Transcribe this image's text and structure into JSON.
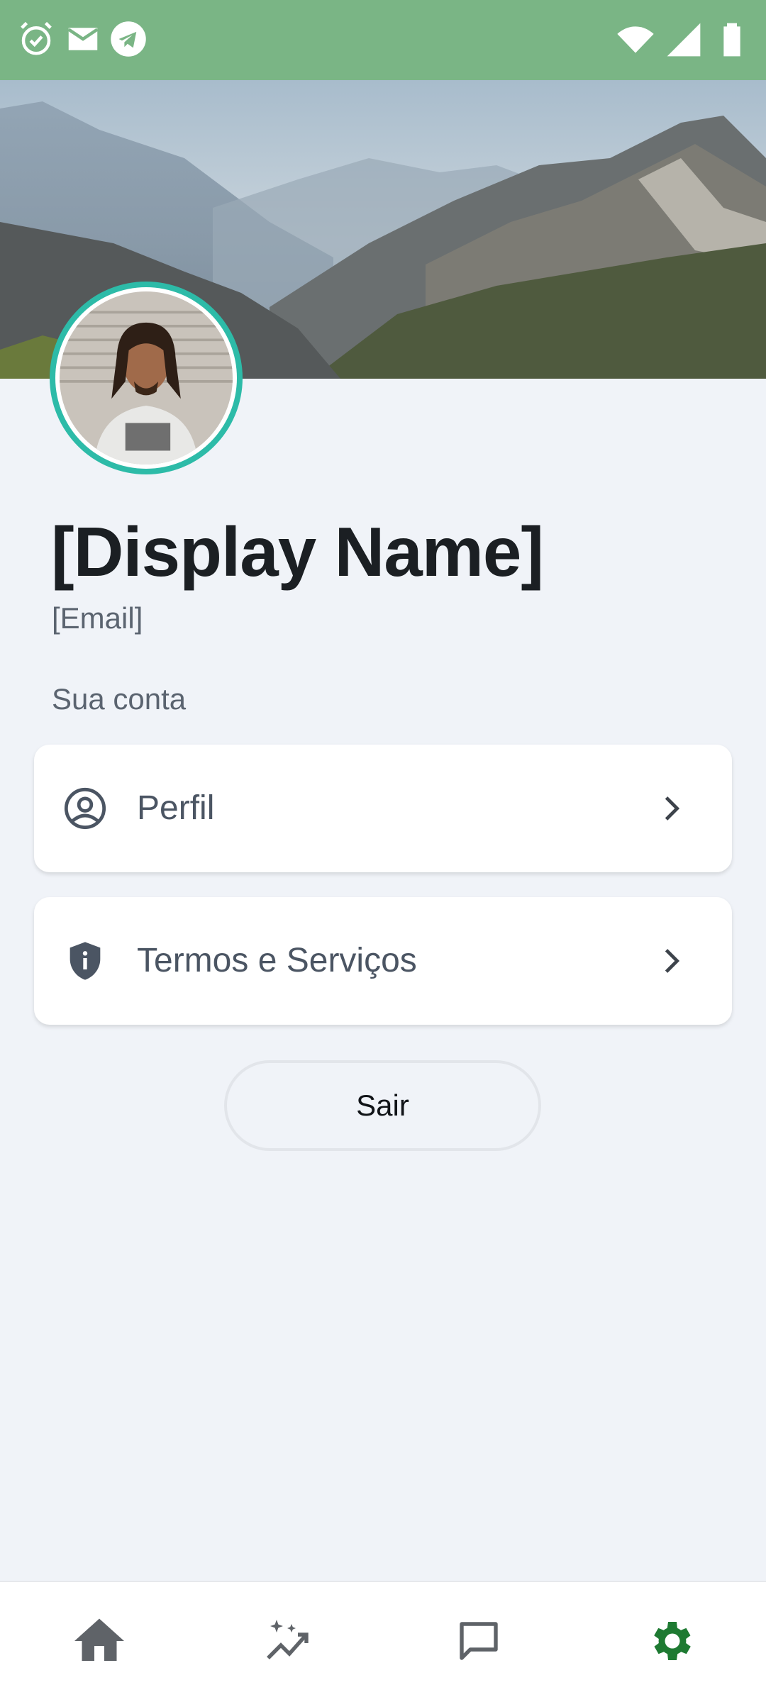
{
  "status_bar": {
    "left_icons": [
      "alarm-icon",
      "mail-icon",
      "telegram-icon"
    ],
    "right_icons": [
      "wifi-icon",
      "signal-icon",
      "battery-icon"
    ],
    "background_color": "#7ab585"
  },
  "header": {
    "banner": "mountain-landscape-image",
    "avatar": "user-photo"
  },
  "profile": {
    "display_name": "[Display Name]",
    "email": "[Email]"
  },
  "account_section": {
    "label": "Sua conta",
    "items": [
      {
        "label": "Perfil",
        "icon": "account-circle-icon"
      },
      {
        "label": "Termos e Serviços",
        "icon": "shield-info-icon"
      }
    ]
  },
  "logout": {
    "label": "Sair"
  },
  "bottom_nav": {
    "items": [
      {
        "id": "home",
        "icon": "home-icon"
      },
      {
        "id": "insights",
        "icon": "sparkle-chart-icon"
      },
      {
        "id": "messages",
        "icon": "chat-icon"
      },
      {
        "id": "settings",
        "icon": "gear-icon",
        "active": true
      }
    ],
    "active_color": "#1e7a32",
    "inactive_color": "#5f6368"
  },
  "colors": {
    "background": "#f0f3f8",
    "avatar_ring": "#2dbba8"
  }
}
